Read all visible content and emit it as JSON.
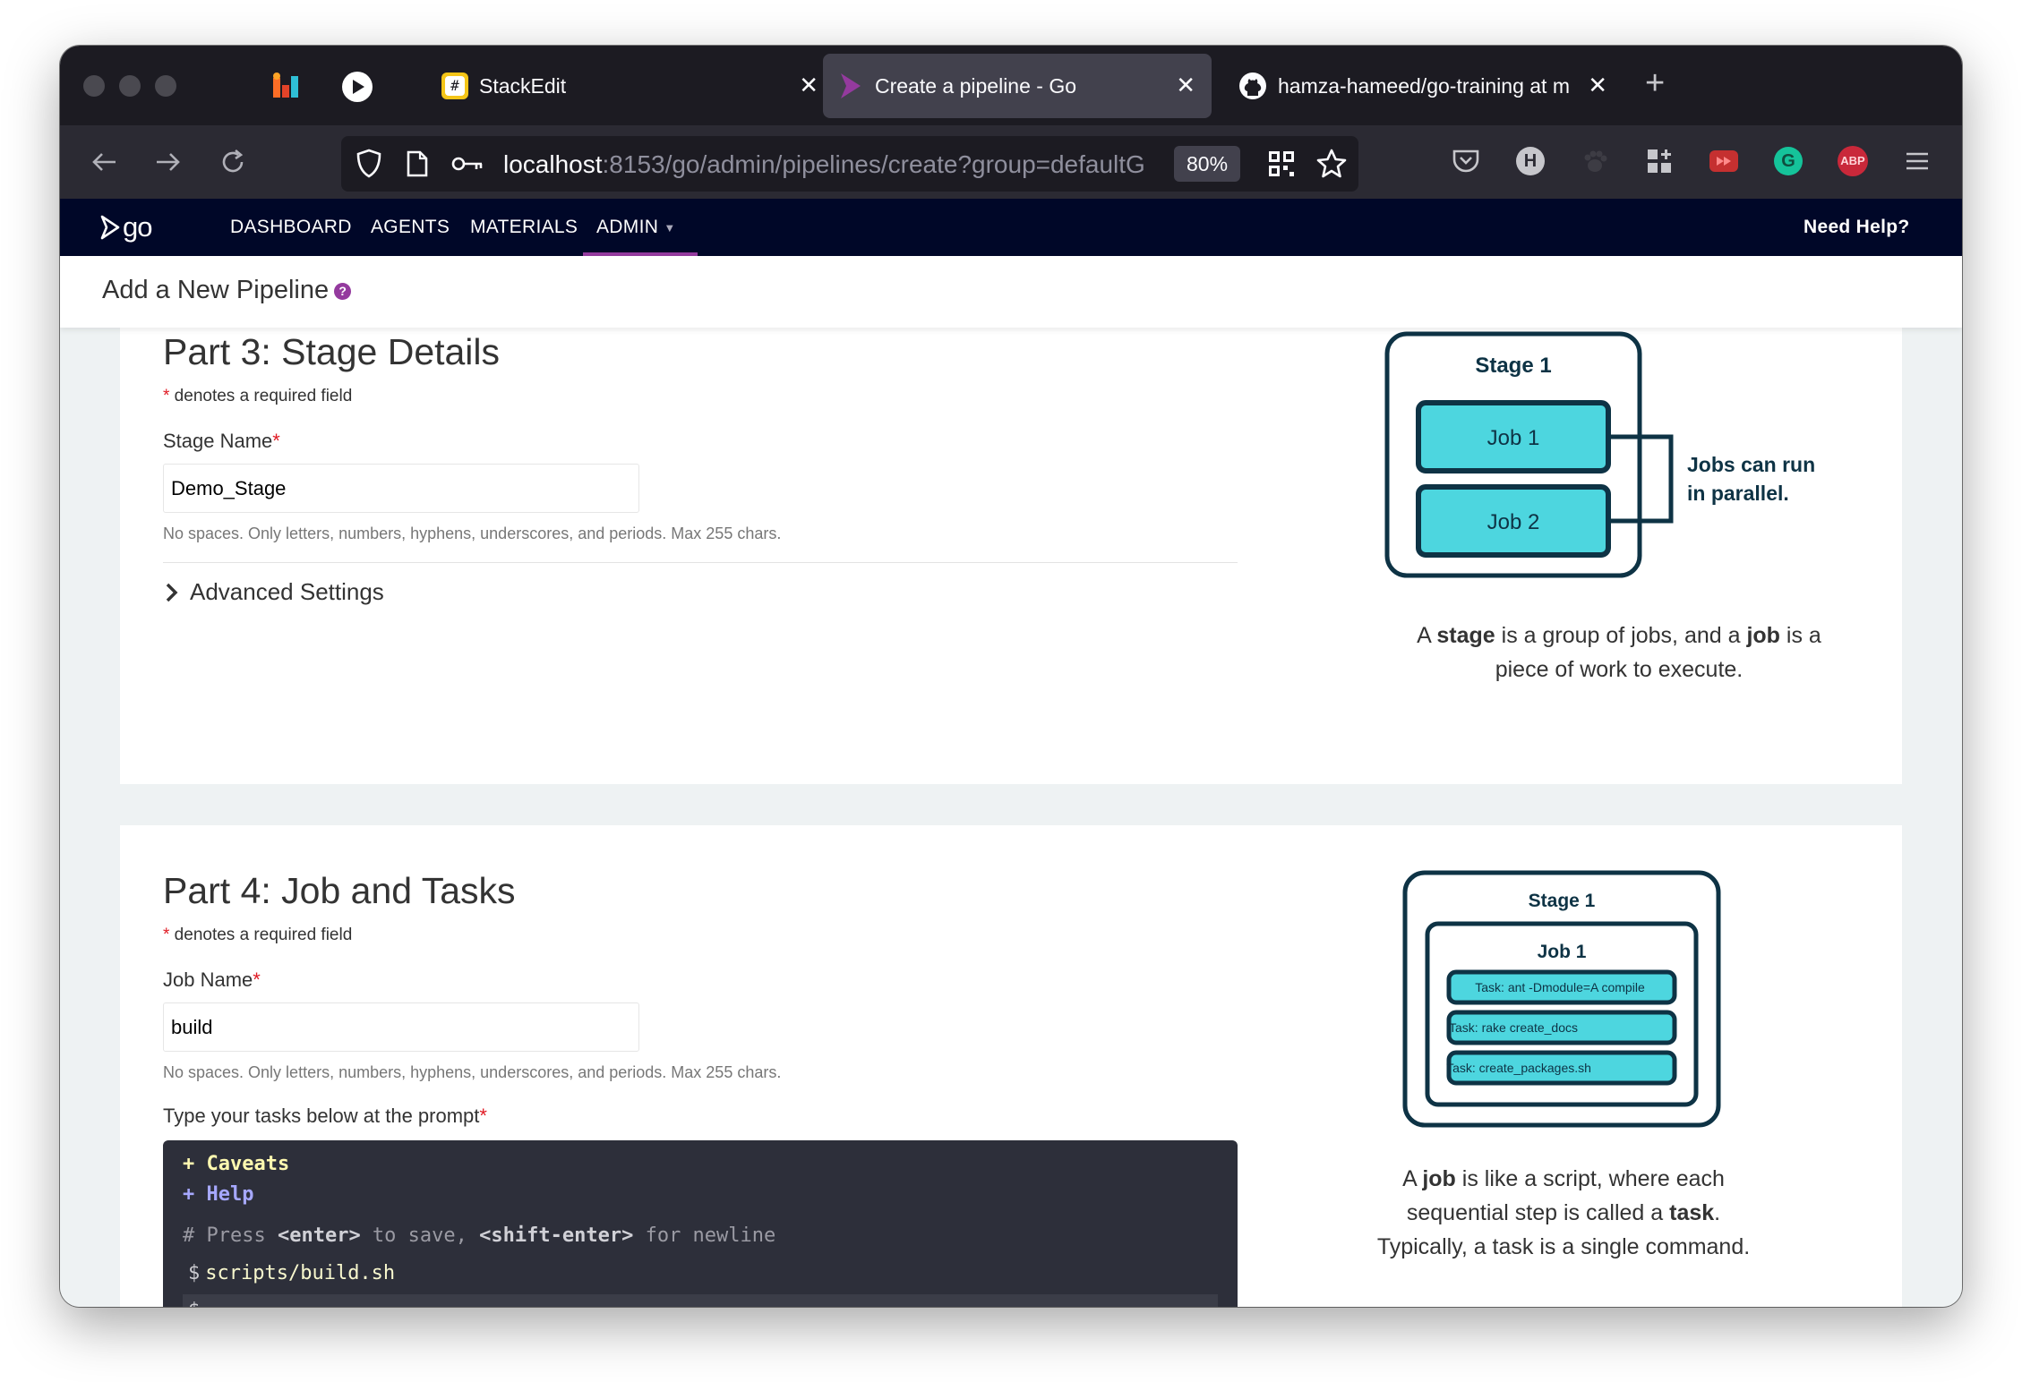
{
  "browser": {
    "tabs": [
      {
        "title": "StackEdit",
        "active": false
      },
      {
        "title": "Create a pipeline - Go",
        "active": true
      },
      {
        "title": "hamza-hameed/go-training at m",
        "active": false
      }
    ],
    "url_host": "localhost",
    "url_rest": ":8153/go/admin/pipelines/create?group=defaultG",
    "zoom": "80%",
    "extension_badges": {
      "h": "H",
      "abp": "ABP",
      "g": "G"
    }
  },
  "app": {
    "logo": "go",
    "nav": [
      "DASHBOARD",
      "AGENTS",
      "MATERIALS",
      "ADMIN"
    ],
    "need_help": "Need Help?",
    "page_title": "Add a New Pipeline",
    "help_icon_glyph": "?"
  },
  "part3": {
    "title": "Part 3: Stage Details",
    "required_star": "*",
    "required_note": " denotes a required field",
    "stage_name_label": "Stage Name",
    "stage_name_value": "Demo_Stage",
    "hint": "No spaces. Only letters, numbers, hyphens, underscores, and periods. Max 255 chars.",
    "advanced": "Advanced Settings",
    "diagram": {
      "stage": "Stage 1",
      "jobs": [
        "Job 1",
        "Job 2"
      ],
      "note_line1": "Jobs can run",
      "note_line2": "in parallel."
    },
    "caption": {
      "p1": "A ",
      "b1": "stage",
      "p2": " is a group of jobs, and a ",
      "b2": "job",
      "p3": " is a",
      "line2": "piece of work to execute."
    }
  },
  "part4": {
    "title": "Part 4: Job and Tasks",
    "required_star": "*",
    "required_note": " denotes a required field",
    "job_name_label": "Job Name",
    "job_name_value": "build",
    "hint": "No spaces. Only letters, numbers, hyphens, underscores, and periods. Max 255 chars.",
    "tasks_label": "Type your tasks below at the prompt",
    "terminal": {
      "caveats": "+ Caveats",
      "help": "+ Help",
      "comment_a": "# Press ",
      "comment_enter": "<enter>",
      "comment_b": " to save, ",
      "comment_shift": "<shift-enter>",
      "comment_c": " for newline",
      "prompt": "$",
      "command": "scripts/build.sh"
    },
    "diagram": {
      "stage": "Stage 1",
      "job": "Job 1",
      "tasks": [
        "Task: ant -Dmodule=A compile",
        "Task: rake create_docs",
        "Task: create_packages.sh"
      ]
    },
    "caption": {
      "p1": "A ",
      "b1": "job",
      "p2": " is like a script, where each",
      "p3": "sequential step is called a ",
      "b2": "task",
      "p4": ".",
      "line3": "Typically, a task is a single command."
    }
  }
}
